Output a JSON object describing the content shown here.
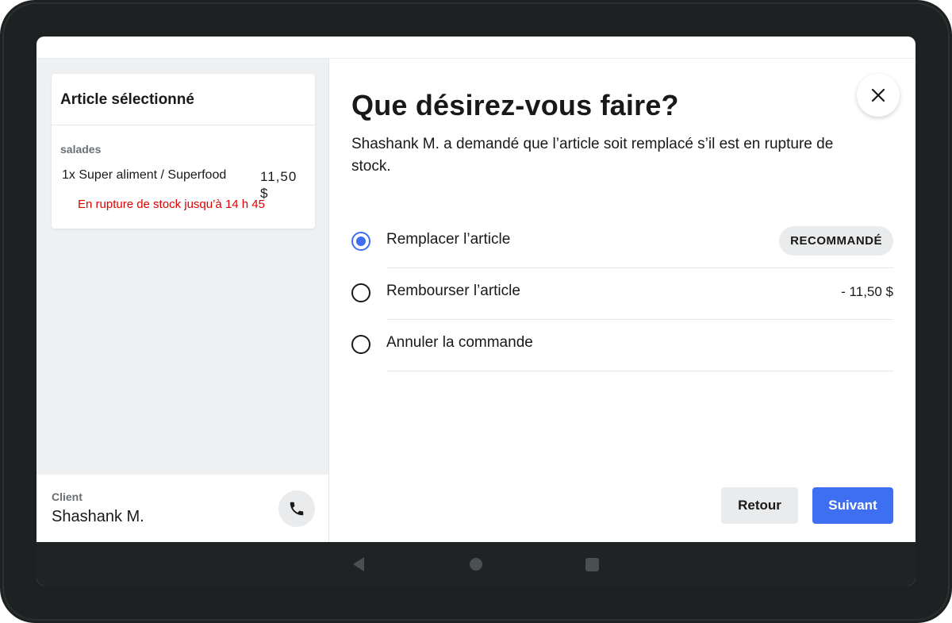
{
  "left": {
    "card": {
      "title": "Article sélectionné",
      "category": "salades",
      "item": "1x Super aliment / Superfood",
      "price": "11,50 $",
      "stock_status": "En rupture de stock jusqu’à 14 h 45",
      "stock_color": "#e00000"
    },
    "client": {
      "label": "Client",
      "name": "Shashank M."
    }
  },
  "main": {
    "title": "Que désirez-vous faire?",
    "description": "Shashank M. a demandé que l’article soit remplacé s’il est en rupture de stock.",
    "options": [
      {
        "label": "Remplacer l’article",
        "badge": "RECOMMANDÉ",
        "selected": true
      },
      {
        "label": "Rembourser l’article",
        "amount": "- 11,50 $",
        "selected": false
      },
      {
        "label": "Annuler la commande",
        "selected": false
      }
    ],
    "buttons": {
      "back": "Retour",
      "next": "Suivant"
    }
  },
  "colors": {
    "accent": "#3d6ff0",
    "neutral_button": "#e9ebec"
  },
  "icons": {
    "close": "close-icon",
    "phone": "phone-icon",
    "nav_back": "nav-back-icon",
    "nav_home": "nav-home-icon",
    "nav_recent": "nav-recent-icon"
  }
}
